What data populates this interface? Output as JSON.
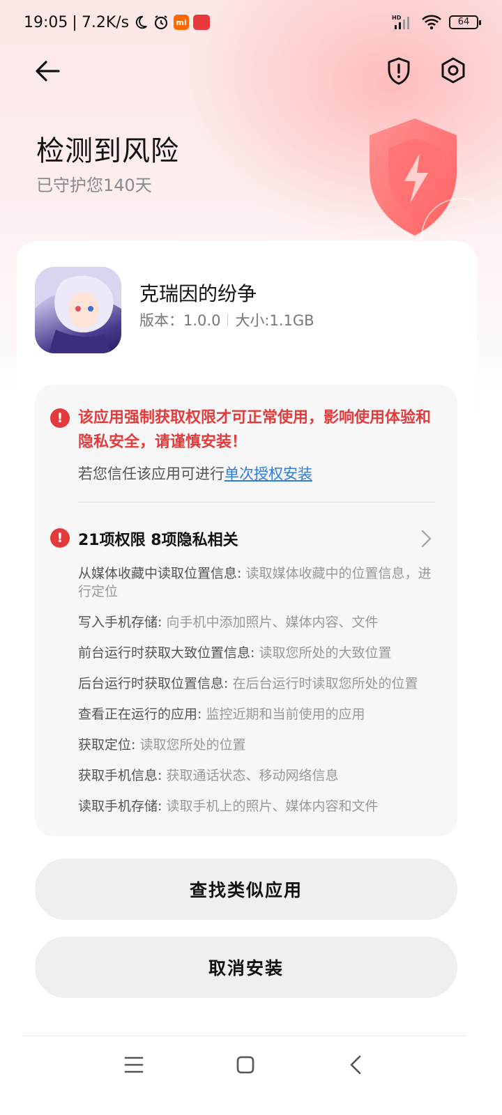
{
  "status_bar": {
    "time": "19:05",
    "speed": "7.2K/s",
    "battery": "64",
    "hd_label": "HD"
  },
  "header": {
    "title": "检测到风险",
    "subtitle": "已守护您140天"
  },
  "app": {
    "name": "克瑞因的纷争",
    "version": "版本：1.0.0",
    "size": "大小:1.1GB"
  },
  "warning": {
    "message": "该应用强制获取权限才可正常使用，影响使用体验和隐私安全，请谨慎安装！",
    "trust_prefix": "若您信任该应用可进行",
    "trust_link": "单次授权安装"
  },
  "permissions": {
    "summary": "21项权限  8项隐私相关",
    "items": [
      {
        "name": "从媒体收藏中读取位置信息: ",
        "desc": "读取媒体收藏中的位置信息，进行定位"
      },
      {
        "name": "写入手机存储: ",
        "desc": "向手机中添加照片、媒体内容、文件"
      },
      {
        "name": "前台运行时获取大致位置信息: ",
        "desc": "读取您所处的大致位置"
      },
      {
        "name": "后台运行时获取位置信息: ",
        "desc": "在后台运行时读取您所处的位置"
      },
      {
        "name": "查看正在运行的应用: ",
        "desc": "监控近期和当前使用的应用"
      },
      {
        "name": "获取定位: ",
        "desc": "读取您所处的位置"
      },
      {
        "name": "获取手机信息: ",
        "desc": "获取通话状态、移动网络信息"
      },
      {
        "name": "读取手机存储: ",
        "desc": "读取手机上的照片、媒体内容和文件"
      }
    ]
  },
  "buttons": {
    "find_similar": "查找类似应用",
    "cancel_install": "取消安装"
  },
  "colors": {
    "danger": "#e33b3b",
    "link": "#2c7be0",
    "button_bg": "#efefef"
  }
}
